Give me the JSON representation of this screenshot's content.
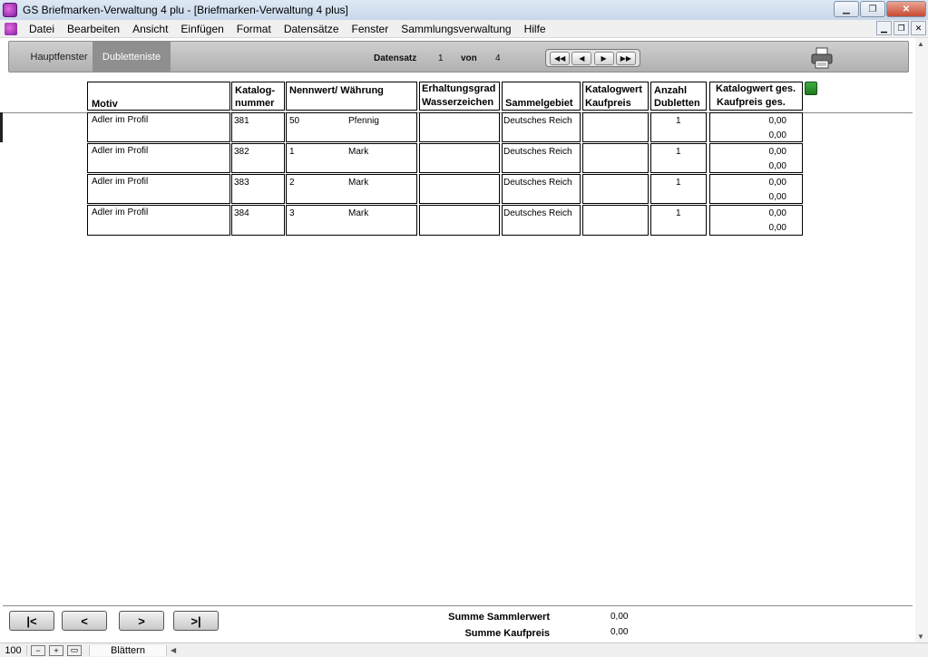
{
  "window": {
    "title": "GS Briefmarken-Verwaltung 4 plu - [Briefmarken-Verwaltung 4 plus]",
    "minimize": "▁",
    "maximize": "❐",
    "close": "✕"
  },
  "menu": [
    "Datei",
    "Bearbeiten",
    "Ansicht",
    "Einfügen",
    "Format",
    "Datensätze",
    "Fenster",
    "Sammlungsverwaltung",
    "Hilfe"
  ],
  "toolbar": {
    "tab_main": "Hauptfenster",
    "tab_duplicates": "Dubletteniste",
    "record_label": "Datensatz",
    "record_current": "1",
    "of_label": "von",
    "record_total": "4",
    "nav_first": "◀◀",
    "nav_prev": "◀",
    "nav_next": "▶",
    "nav_last": "▶▶"
  },
  "table": {
    "headers": {
      "motiv": "Motiv",
      "katalog_1": "Katalog-",
      "katalog_2": "nummer",
      "nennwert": "Nennwert/ Währung",
      "erhaltung_1": "Erhaltungsgrad",
      "erhaltung_2": "Wasserzeichen",
      "sammelgebiet": "Sammelgebiet",
      "katwert_1": "Katalogwert",
      "katwert_2": "Kaufpreis",
      "anzahl_1": "Anzahl",
      "anzahl_2": "Dubletten",
      "gesamt_1": "Katalogwert ges.",
      "gesamt_2": "Kaufpreis ges."
    },
    "rows": [
      {
        "motiv": "Adler im Profil",
        "katalog": "381",
        "nennwert": "50",
        "waehrung": "Pfennig",
        "erhaltung": "",
        "sammelgebiet": "Deutsches Reich",
        "katwert": "",
        "anzahl": "1",
        "kat_ges": "0,00",
        "kauf_ges": "0,00"
      },
      {
        "motiv": "Adler im Profil",
        "katalog": "382",
        "nennwert": "1",
        "waehrung": "Mark",
        "erhaltung": "",
        "sammelgebiet": "Deutsches Reich",
        "katwert": "",
        "anzahl": "1",
        "kat_ges": "0,00",
        "kauf_ges": "0,00"
      },
      {
        "motiv": "Adler im Profil",
        "katalog": "383",
        "nennwert": "2",
        "waehrung": "Mark",
        "erhaltung": "",
        "sammelgebiet": "Deutsches Reich",
        "katwert": "",
        "anzahl": "1",
        "kat_ges": "0,00",
        "kauf_ges": "0,00"
      },
      {
        "motiv": "Adler im Profil",
        "katalog": "384",
        "nennwert": "3",
        "waehrung": "Mark",
        "erhaltung": "",
        "sammelgebiet": "Deutsches Reich",
        "katwert": "",
        "anzahl": "1",
        "kat_ges": "0,00",
        "kauf_ges": "0,00"
      }
    ]
  },
  "bottom": {
    "btn_first": "|<",
    "btn_prev": "<",
    "btn_next": ">",
    "btn_last": ">|",
    "sum_collector_label": "Summe Sammlerwert",
    "sum_collector_value": "0,00",
    "sum_purchase_label": "Summe Kaufpreis",
    "sum_purchase_value": "0,00"
  },
  "statusbar": {
    "zoom": "100",
    "zoom_out": "−",
    "zoom_in": "+",
    "layout": "▭",
    "mode": "Blättern"
  },
  "colors": {
    "accent_led": "#2f9a2f",
    "tab_active": "#8f8f8f"
  }
}
